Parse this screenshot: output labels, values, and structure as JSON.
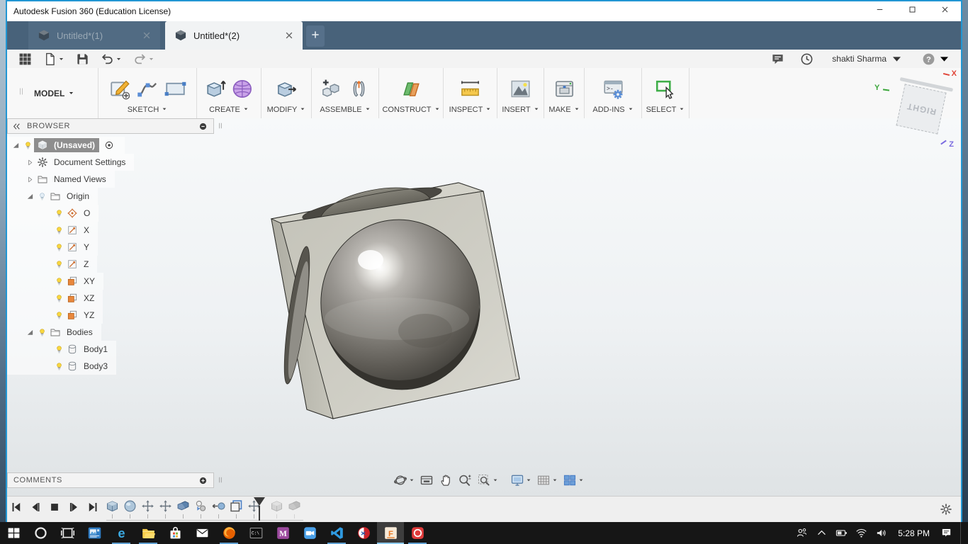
{
  "window": {
    "title": "Autodesk Fusion 360 (Education License)",
    "controls": [
      "minimize",
      "maximize",
      "close"
    ]
  },
  "tabs": {
    "items": [
      {
        "label": "Untitled*(1)",
        "active": false
      },
      {
        "label": "Untitled*(2)",
        "active": true
      }
    ],
    "new_tab": "+"
  },
  "qat": {
    "left": [
      {
        "name": "app-grid"
      },
      {
        "name": "file",
        "dropdown": true
      },
      {
        "name": "save"
      },
      {
        "name": "undo",
        "dropdown": true
      },
      {
        "name": "redo",
        "dropdown": true,
        "disabled": true
      }
    ],
    "right": [
      {
        "name": "comment"
      },
      {
        "name": "job-status"
      }
    ]
  },
  "account": {
    "user_name": "shakti Sharma",
    "help_label": "?"
  },
  "ribbon": {
    "workspace_label": "MODEL",
    "groups": [
      {
        "label": "SKETCH",
        "width": 138,
        "icons": [
          "create-sketch",
          "spline",
          "rectangle"
        ]
      },
      {
        "label": "CREATE",
        "width": 90,
        "icons": [
          "extrude",
          "form"
        ]
      },
      {
        "label": "MODIFY",
        "width": 70,
        "icons": [
          "press-pull"
        ]
      },
      {
        "label": "ASSEMBLE",
        "width": 94,
        "icons": [
          "new-component",
          "joint"
        ]
      },
      {
        "label": "CONSTRUCT",
        "width": 90,
        "icons": [
          "plane"
        ]
      },
      {
        "label": "INSPECT",
        "width": 75,
        "icons": [
          "measure"
        ]
      },
      {
        "label": "INSERT",
        "width": 65,
        "icons": [
          "insert-image"
        ]
      },
      {
        "label": "MAKE",
        "width": 56,
        "icons": [
          "print-3d"
        ]
      },
      {
        "label": "ADD-INS",
        "width": 80,
        "icons": [
          "scripts"
        ]
      },
      {
        "label": "SELECT",
        "width": 66,
        "icons": [
          "select"
        ]
      }
    ]
  },
  "browser": {
    "header": "BROWSER",
    "items": [
      {
        "label": "(Unsaved)",
        "level": 0,
        "icon": "component",
        "bulb": "on",
        "expanded": true,
        "selected": true,
        "suffix": "radio"
      },
      {
        "label": "Document Settings",
        "level": 1,
        "icon": "gear",
        "expanded": false
      },
      {
        "label": "Named Views",
        "level": 1,
        "icon": "folder",
        "expanded": false
      },
      {
        "label": "Origin",
        "level": 1,
        "icon": "folder",
        "bulb": "off",
        "expanded": true
      },
      {
        "label": "O",
        "level": 2,
        "icon": "origin-point",
        "bulb": "on"
      },
      {
        "label": "X",
        "level": 2,
        "icon": "axis",
        "bulb": "on"
      },
      {
        "label": "Y",
        "level": 2,
        "icon": "axis",
        "bulb": "on"
      },
      {
        "label": "Z",
        "level": 2,
        "icon": "axis",
        "bulb": "on"
      },
      {
        "label": "XY",
        "level": 2,
        "icon": "plane-face",
        "bulb": "on"
      },
      {
        "label": "XZ",
        "level": 2,
        "icon": "plane-face",
        "bulb": "on"
      },
      {
        "label": "YZ",
        "level": 2,
        "icon": "plane-face",
        "bulb": "on"
      },
      {
        "label": "Bodies",
        "level": 1,
        "icon": "folder",
        "bulb": "on",
        "expanded": true
      },
      {
        "label": "Body1",
        "level": 2,
        "icon": "body",
        "bulb": "on"
      },
      {
        "label": "Body3",
        "level": 2,
        "icon": "body",
        "bulb": "on"
      }
    ]
  },
  "comments": {
    "header": "COMMENTS"
  },
  "viewcube": {
    "face_label": "RIGHT",
    "axis_labels": {
      "x": "X",
      "y": "Y",
      "z": "Z"
    }
  },
  "navbar": {
    "items": [
      {
        "name": "orbit",
        "dropdown": true
      },
      {
        "name": "look-at",
        "dropdown": false
      },
      {
        "name": "pan",
        "dropdown": false
      },
      {
        "name": "zoom",
        "dropdown": false
      },
      {
        "name": "fit",
        "dropdown": true
      },
      {
        "name": "display",
        "dropdown": true,
        "gap": true
      },
      {
        "name": "grid-display",
        "dropdown": true
      },
      {
        "name": "viewports",
        "dropdown": true
      }
    ]
  },
  "timeline": {
    "playback": [
      "skip-start",
      "step-back",
      "stop",
      "play",
      "skip-end"
    ],
    "features": [
      "box",
      "sphere",
      "move",
      "move",
      "combine",
      "copy",
      "point",
      "frame",
      "move"
    ],
    "rolled_back": [
      "box",
      "combine"
    ]
  },
  "taskbar": {
    "apps": [
      {
        "name": "start"
      },
      {
        "name": "cortana"
      },
      {
        "name": "task-view"
      },
      {
        "name": "photos"
      },
      {
        "name": "edge",
        "running": true
      },
      {
        "name": "file-explorer",
        "running": true
      },
      {
        "name": "store"
      },
      {
        "name": "mail"
      },
      {
        "name": "firefox",
        "running": true
      },
      {
        "name": "command-prompt"
      },
      {
        "name": "musescore"
      },
      {
        "name": "camera"
      },
      {
        "name": "vscode",
        "running": true
      },
      {
        "name": "red-white-app"
      },
      {
        "name": "fusion-360",
        "running": true,
        "active": true
      },
      {
        "name": "red-circle-app",
        "running": true
      }
    ],
    "tray": {
      "icons": [
        "people",
        "chevron-up",
        "battery",
        "wifi",
        "volume"
      ],
      "time": "5:28 PM",
      "after": [
        "action-center"
      ]
    }
  }
}
